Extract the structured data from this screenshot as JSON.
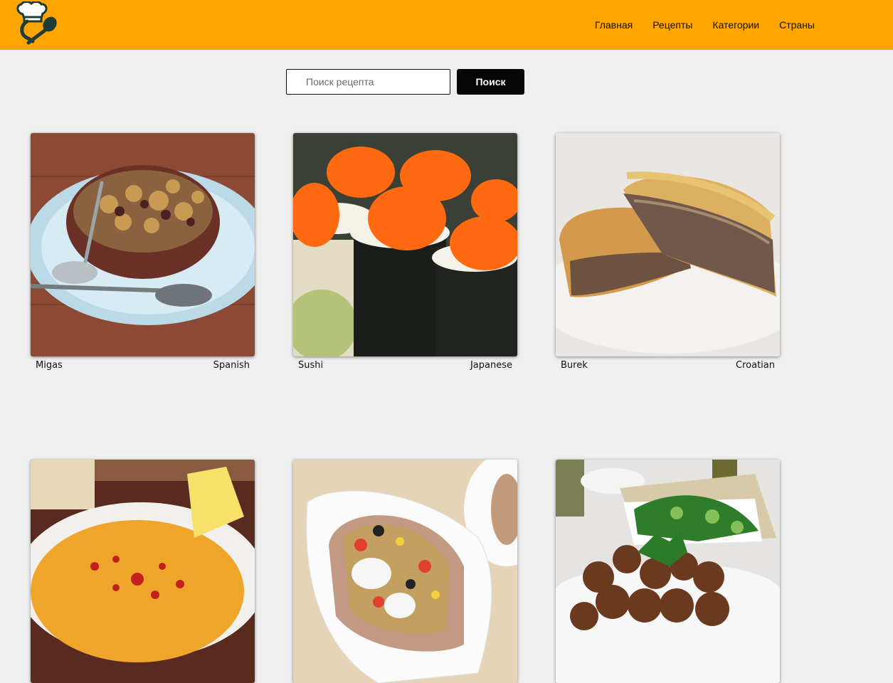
{
  "header": {
    "logo_icon": "chef-hat-spoon-logo-icon",
    "nav": [
      {
        "label": "Главная"
      },
      {
        "label": "Рецепты"
      },
      {
        "label": "Категории"
      },
      {
        "label": "Страны"
      }
    ],
    "background": "#ffa500"
  },
  "search": {
    "placeholder": "Поиск рецепта",
    "value": "",
    "button_label": "Поиск"
  },
  "recipes": [
    {
      "name": "Migas",
      "country": "Spanish",
      "image": "migas-dish-image"
    },
    {
      "name": "Sushi",
      "country": "Japanese",
      "image": "sushi-rolls-image"
    },
    {
      "name": "Burek",
      "country": "Croatian",
      "image": "burek-pastry-image"
    },
    {
      "name": "",
      "country": "",
      "image": "lentil-soup-image"
    },
    {
      "name": "",
      "country": "",
      "image": "stuffed-potato-image"
    },
    {
      "name": "",
      "country": "",
      "image": "falafel-plate-image"
    }
  ]
}
